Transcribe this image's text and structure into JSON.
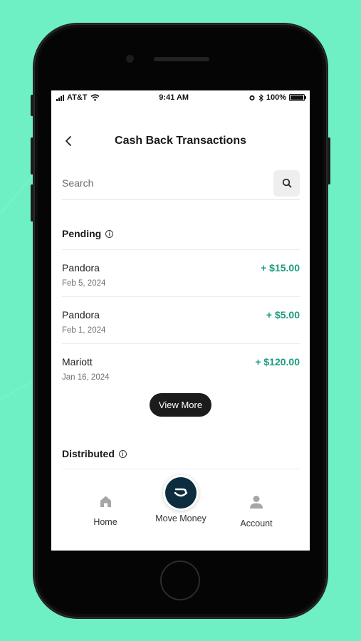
{
  "status_bar": {
    "carrier": "AT&T",
    "time": "9:41 AM",
    "battery": "100%"
  },
  "header": {
    "title": "Cash Back Transactions"
  },
  "search": {
    "placeholder": "Search"
  },
  "pending": {
    "heading": "Pending",
    "items": [
      {
        "name": "Pandora",
        "date": "Feb 5, 2024",
        "amount": "+ $15.00"
      },
      {
        "name": "Pandora",
        "date": "Feb 1, 2024",
        "amount": "+ $5.00"
      },
      {
        "name": "Mariott",
        "date": "Jan 16, 2024",
        "amount": "+ $120.00"
      }
    ],
    "view_more_label": "View More"
  },
  "distributed": {
    "heading": "Distributed"
  },
  "tabbar": {
    "home_label": "Home",
    "move_money_label": "Move Money",
    "account_label": "Account"
  },
  "colors": {
    "background": "#6EEFC4",
    "accent_green": "#1E9A80",
    "fab_navy": "#0b2d3f"
  }
}
